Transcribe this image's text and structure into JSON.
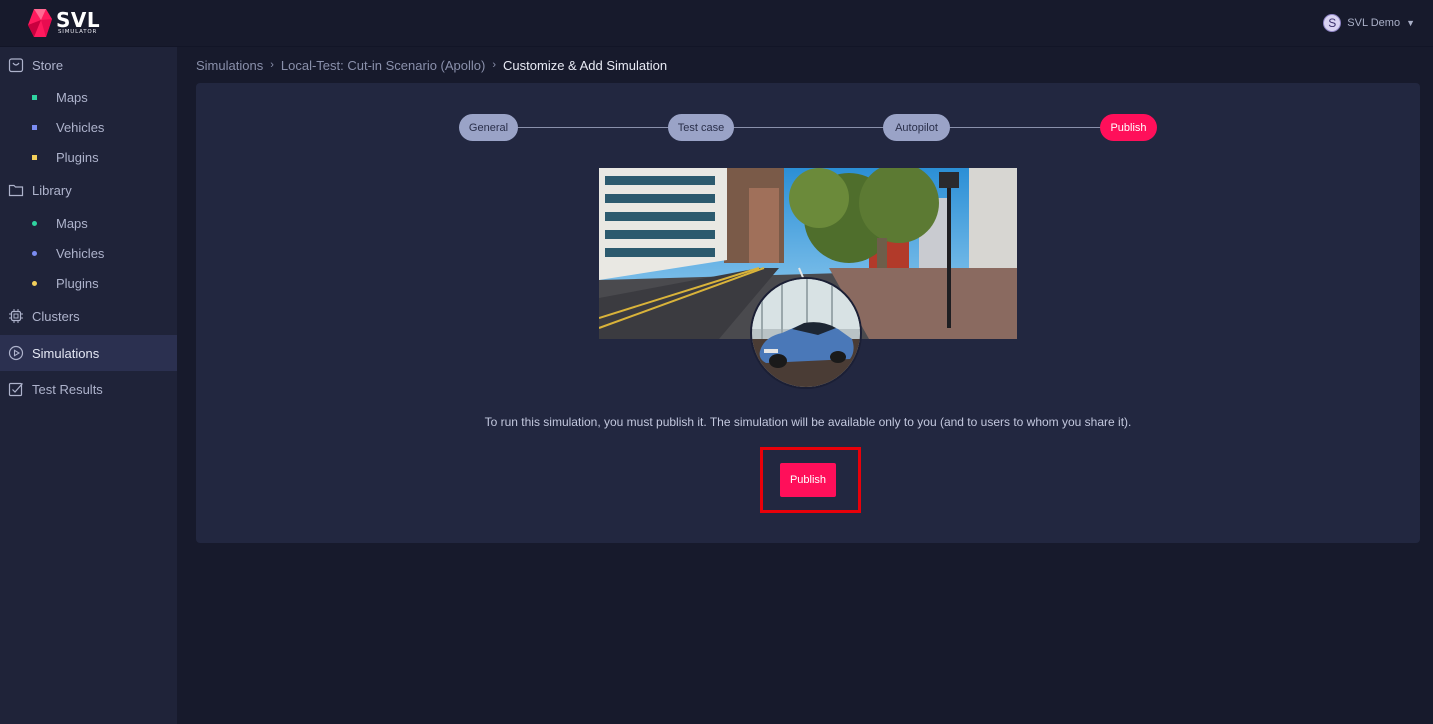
{
  "app": {
    "brand": "SVL",
    "brand_sub": "SIMULATOR",
    "user_initial": "S",
    "user_name": "SVL Demo",
    "accent_color": "#ff0f5a"
  },
  "sidebar": {
    "store": {
      "label": "Store",
      "icon": "shopping-bag-icon",
      "items": [
        {
          "label": "Maps",
          "dot_color": "#2fd3a0"
        },
        {
          "label": "Vehicles",
          "dot_color": "#7b8cf2"
        },
        {
          "label": "Plugins",
          "dot_color": "#f2cf5b"
        }
      ]
    },
    "library": {
      "label": "Library",
      "icon": "folder-icon",
      "items": [
        {
          "label": "Maps",
          "dot_color": "#2fd3a0"
        },
        {
          "label": "Vehicles",
          "dot_color": "#7b8cf2"
        },
        {
          "label": "Plugins",
          "dot_color": "#f2cf5b"
        }
      ]
    },
    "clusters": {
      "label": "Clusters",
      "icon": "cpu-chip-icon"
    },
    "simulations": {
      "label": "Simulations",
      "icon": "play-circle-icon",
      "active": true
    },
    "test_results": {
      "label": "Test Results",
      "icon": "checklist-icon"
    }
  },
  "breadcrumb": {
    "items": [
      "Simulations",
      "Local-Test: Cut-in Scenario (Apollo)"
    ],
    "current": "Customize & Add Simulation",
    "separator": "›"
  },
  "stepper": {
    "steps": [
      {
        "label": "General",
        "state": "done"
      },
      {
        "label": "Test case",
        "state": "done"
      },
      {
        "label": "Autopilot",
        "state": "done"
      },
      {
        "label": "Publish",
        "state": "current"
      }
    ]
  },
  "publish": {
    "message": "To run this simulation, you must publish it. The simulation will be available only to you (and to users to whom you share it).",
    "button_label": "Publish"
  }
}
